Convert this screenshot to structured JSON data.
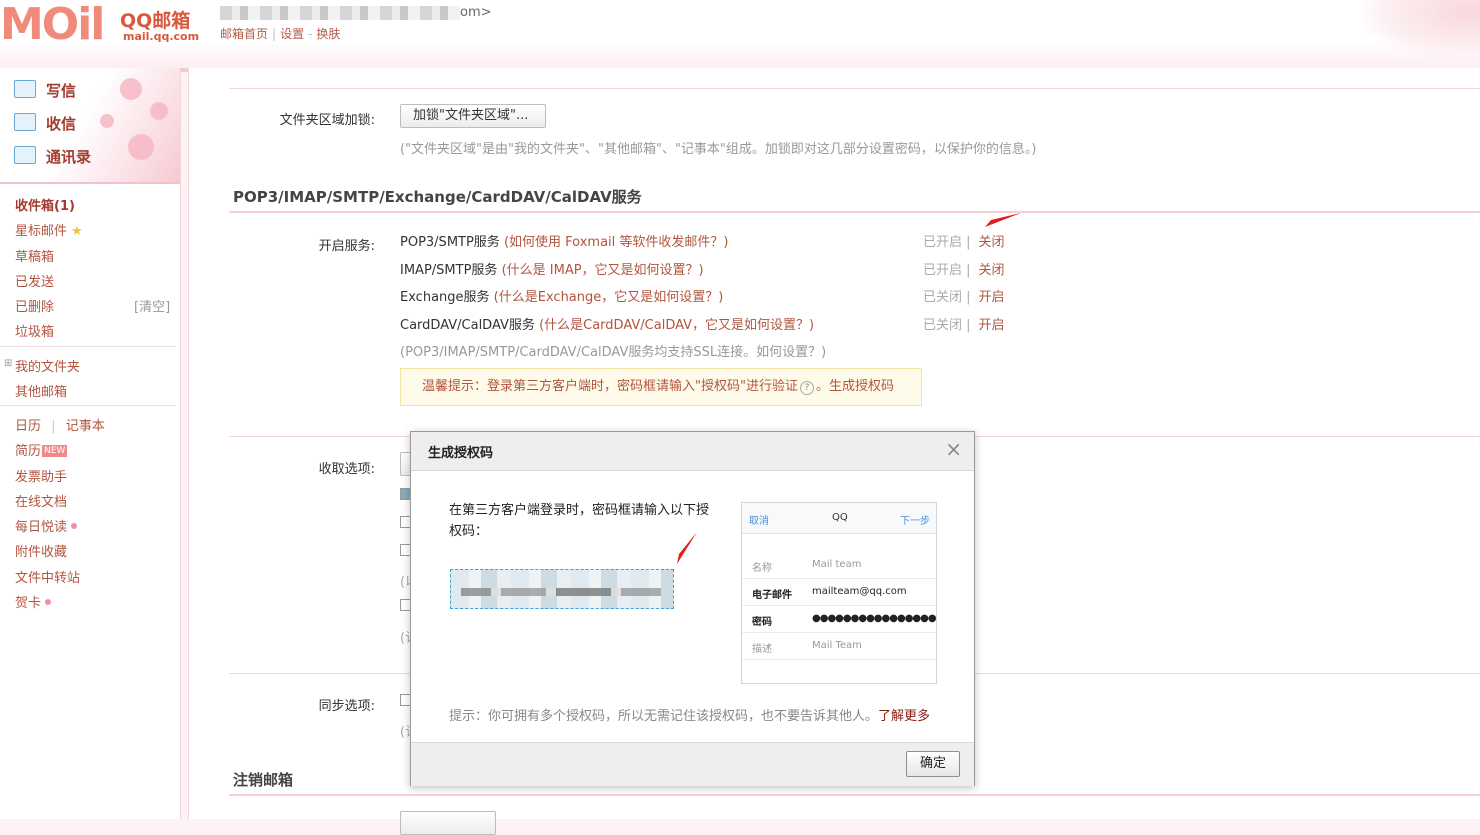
{
  "header": {
    "logo_text": "MOil",
    "logo_brand": "QQ邮箱",
    "logo_domain": "mail.qq.com",
    "account_suffix": "om>",
    "nav": {
      "home": "邮箱首页",
      "sep1": "|",
      "settings": "设置",
      "sep2": "-",
      "skin": "换肤"
    }
  },
  "sidebar": {
    "compose": "写信",
    "receive": "收信",
    "contacts": "通讯录",
    "folders": {
      "inbox": "收件箱(1)",
      "starred": "星标邮件",
      "drafts": "草稿箱",
      "sent": "已发送",
      "deleted": "已删除",
      "clear": "[清空]",
      "spam": "垃圾箱",
      "my_folders": "我的文件夹",
      "other_mail": "其他邮箱",
      "calendar": "日历",
      "cal_sep": "|",
      "notes": "记事本",
      "resume": "简历",
      "resume_badge": "NEW",
      "invoice": "发票助手",
      "docs": "在线文档",
      "daily": "每日悦读",
      "attachments": "附件收藏",
      "transfer": "文件中转站",
      "cards": "贺卡"
    }
  },
  "main": {
    "folder_lock_label": "文件夹区域加锁:",
    "folder_lock_button": "加锁\"文件夹区域\"...",
    "folder_lock_note": "(\"文件夹区域\"是由\"我的文件夹\"、\"其他邮箱\"、\"记事本\"组成。加锁即对这几部分设置密码，以保护你的信息。)",
    "pop_section_title": "POP3/IMAP/SMTP/Exchange/CardDAV/CalDAV服务",
    "enable_label": "开启服务:",
    "services": [
      {
        "name": "POP3/SMTP服务",
        "question": "(如何使用 Foxmail 等软件收发邮件？)",
        "state": "已开启",
        "sep": "|",
        "action": "关闭"
      },
      {
        "name": "IMAP/SMTP服务",
        "question": "(什么是 IMAP，它又是如何设置？)",
        "state": "已开启",
        "sep": "|",
        "action": "关闭"
      },
      {
        "name": "Exchange服务",
        "question": "(什么是Exchange，它又是如何设置？)",
        "state": "已关闭",
        "sep": "|",
        "action": "开启"
      },
      {
        "name": "CardDAV/CalDAV服务",
        "question": "(什么是CardDAV/CalDAV，它又是如何设置？)",
        "state": "已关闭",
        "sep": "|",
        "action": "开启"
      }
    ],
    "ssl_note": "(POP3/IMAP/SMTP/CardDAV/CalDAV服务均支持SSL连接。如何设置？)",
    "tip_text": "温馨提示：登录第三方客户端时，密码框请输入\"授权码\"进行验证",
    "tip_help_icon": "?",
    "tip_link": "。生成授权码",
    "receive_label": "收取选项:",
    "frag1": "(以",
    "frag2": "(记",
    "sync_label": "同步选项:",
    "frag3": "(记",
    "cancel_section_title": "注销邮箱"
  },
  "modal": {
    "title": "生成授权码",
    "close": "×",
    "desc": "在第三方客户端登录时，密码框请输入以下授权码：",
    "phone": {
      "cancel": "取消",
      "title": "QQ",
      "next": "下一步",
      "rows": [
        {
          "k": "名称",
          "v": "Mail team"
        },
        {
          "k": "电子邮件",
          "v": "mailteam@qq.com"
        },
        {
          "k": "密码",
          "v": "●●●●●●●●●●●●●●●●"
        },
        {
          "k": "描述",
          "v": "Mail Team"
        }
      ]
    },
    "hint": "提示：你可拥有多个授权码，所以无需记住该授权码，也不要告诉其他人。",
    "learn_more": "了解更多",
    "ok_button": "确定"
  },
  "colors": {
    "accent": "#b2553f",
    "brand": "#d9573b",
    "link_dark": "#8b1a12",
    "pink_border": "#f3d6dc"
  }
}
